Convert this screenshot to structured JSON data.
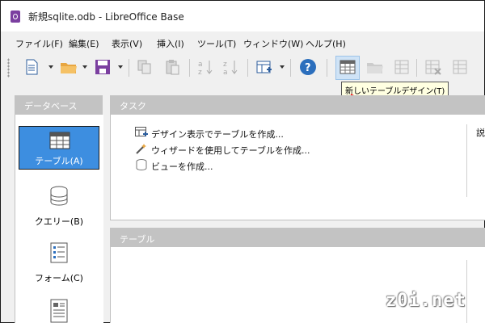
{
  "window": {
    "title": "新規sqlite.odb - LibreOffice Base"
  },
  "menu": [
    "ファイル(F)",
    "編集(E)",
    "表示(V)",
    "挿入(I)",
    "ツール(T)",
    "ウィンドウ(W)",
    "ヘルプ(H)"
  ],
  "toolbar": {
    "tooltip": "新しいテーブルデザイン(T)",
    "buttons": [
      "new-document-icon",
      "open-folder-icon",
      "save-icon",
      "copy-icon",
      "paste-icon",
      "sort-ascending-icon",
      "sort-descending-icon",
      "form-report-icon",
      "help-icon",
      "new-table-design-icon",
      "open-table-icon",
      "edit-table-icon",
      "delete-table-icon",
      "rename-table-icon"
    ]
  },
  "left_pane": {
    "header": "データベース",
    "items": [
      "テーブル(A)",
      "クエリー(B)",
      "フォーム(C)",
      ""
    ]
  },
  "tasks": {
    "header": "タスク",
    "items": [
      "デザイン表示でテーブルを作成...",
      "ウィザードを使用してテーブルを作成...",
      "ビューを作成..."
    ],
    "description_label": "説"
  },
  "tables": {
    "header": "テーブル"
  },
  "watermark": "z0i.net",
  "colors": {
    "selected": "#3d8ee0",
    "header_bg": "#c3c3c3",
    "tooltip_bg": "#ffffe1",
    "arrow": "#ff0000"
  }
}
